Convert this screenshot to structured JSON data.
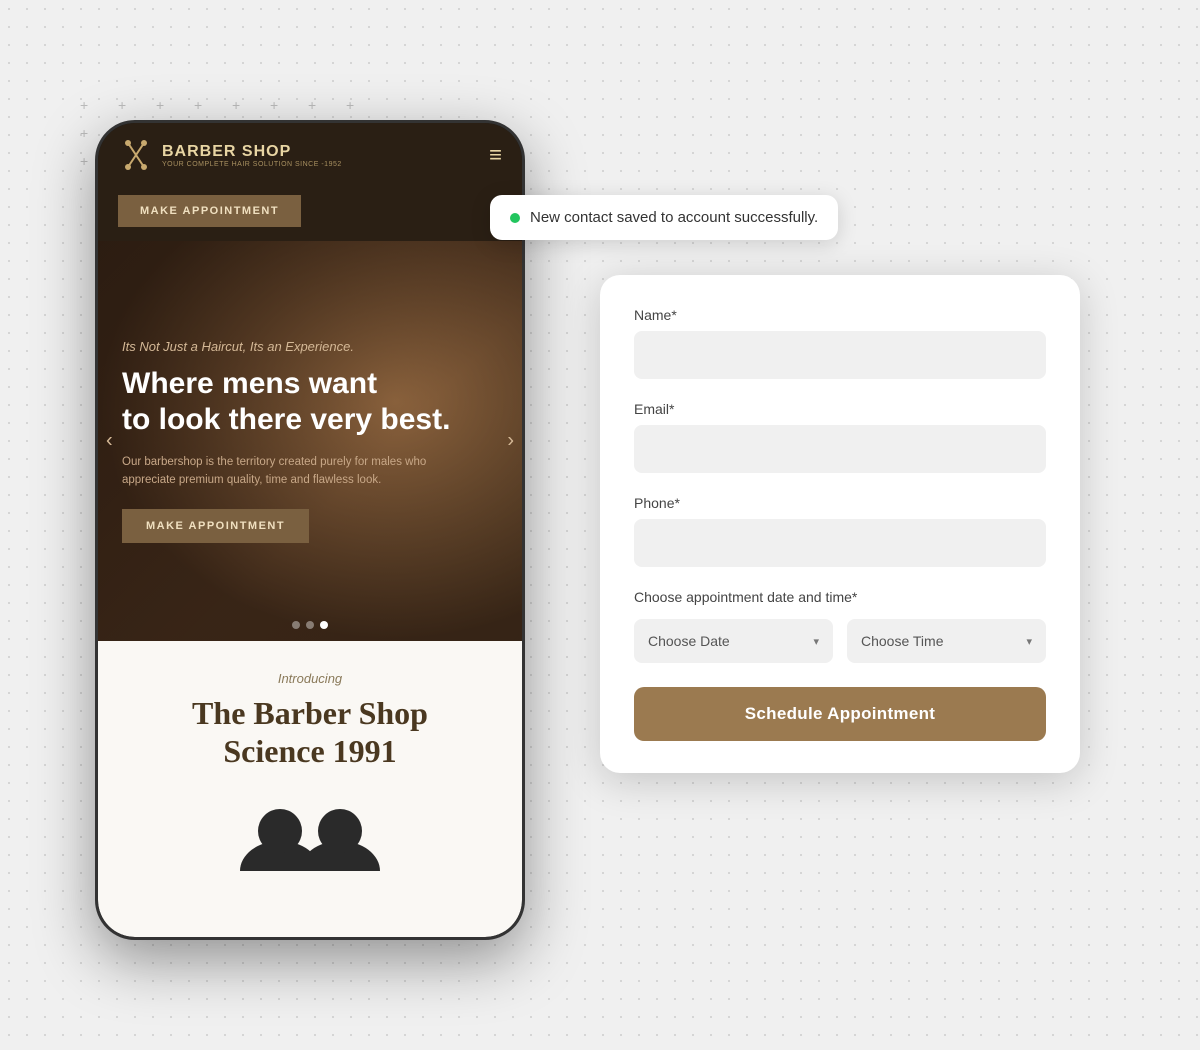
{
  "background": {
    "dots": true,
    "lines": [
      100,
      140,
      180,
      220,
      260,
      300,
      340,
      380,
      420,
      460,
      500,
      540,
      580,
      620,
      660,
      700,
      740,
      780,
      820,
      860,
      900,
      940,
      980,
      1020
    ]
  },
  "plus_grid": {
    "rows": 3,
    "cols": 8,
    "symbol": "+"
  },
  "phone": {
    "logo_title": "BARBER SHOP",
    "logo_sub": "YOUR COMPLETE HAIR SOLUTION SINCE -1952",
    "hamburger": "≡",
    "make_appointment_btn": "MAKE APPOINTMENT",
    "hero": {
      "tagline": "Its Not Just a Haircut, Its an Experience.",
      "headline": "Where mens want\nto look there very best.",
      "description": "Our barbershop is the territory created purely for males who\nappreciate premium quality, time and flawless look.",
      "cta_btn": "MAKE APPOINTMENT",
      "arrow_left": "‹",
      "arrow_right": "›",
      "dots": [
        false,
        false,
        true
      ]
    },
    "bottom": {
      "introducing": "Introducing",
      "title": "The Barber Shop\nScience 1991"
    }
  },
  "toast": {
    "text": "New contact saved to account successfully."
  },
  "form": {
    "name_label": "Name*",
    "name_placeholder": "",
    "email_label": "Email*",
    "email_placeholder": "",
    "phone_label": "Phone*",
    "phone_placeholder": "",
    "datetime_label": "Choose appointment date and time*",
    "choose_date_btn": "Choose Date",
    "choose_time_btn": "Choose Time",
    "dropdown_arrow": "▾",
    "schedule_btn": "Schedule Appointment"
  },
  "colors": {
    "brand_brown": "#9b7a50",
    "dark_brown": "#2a1f14",
    "toast_green": "#22c55e",
    "form_bg": "#ffffff",
    "input_bg": "#f0f0f0"
  }
}
